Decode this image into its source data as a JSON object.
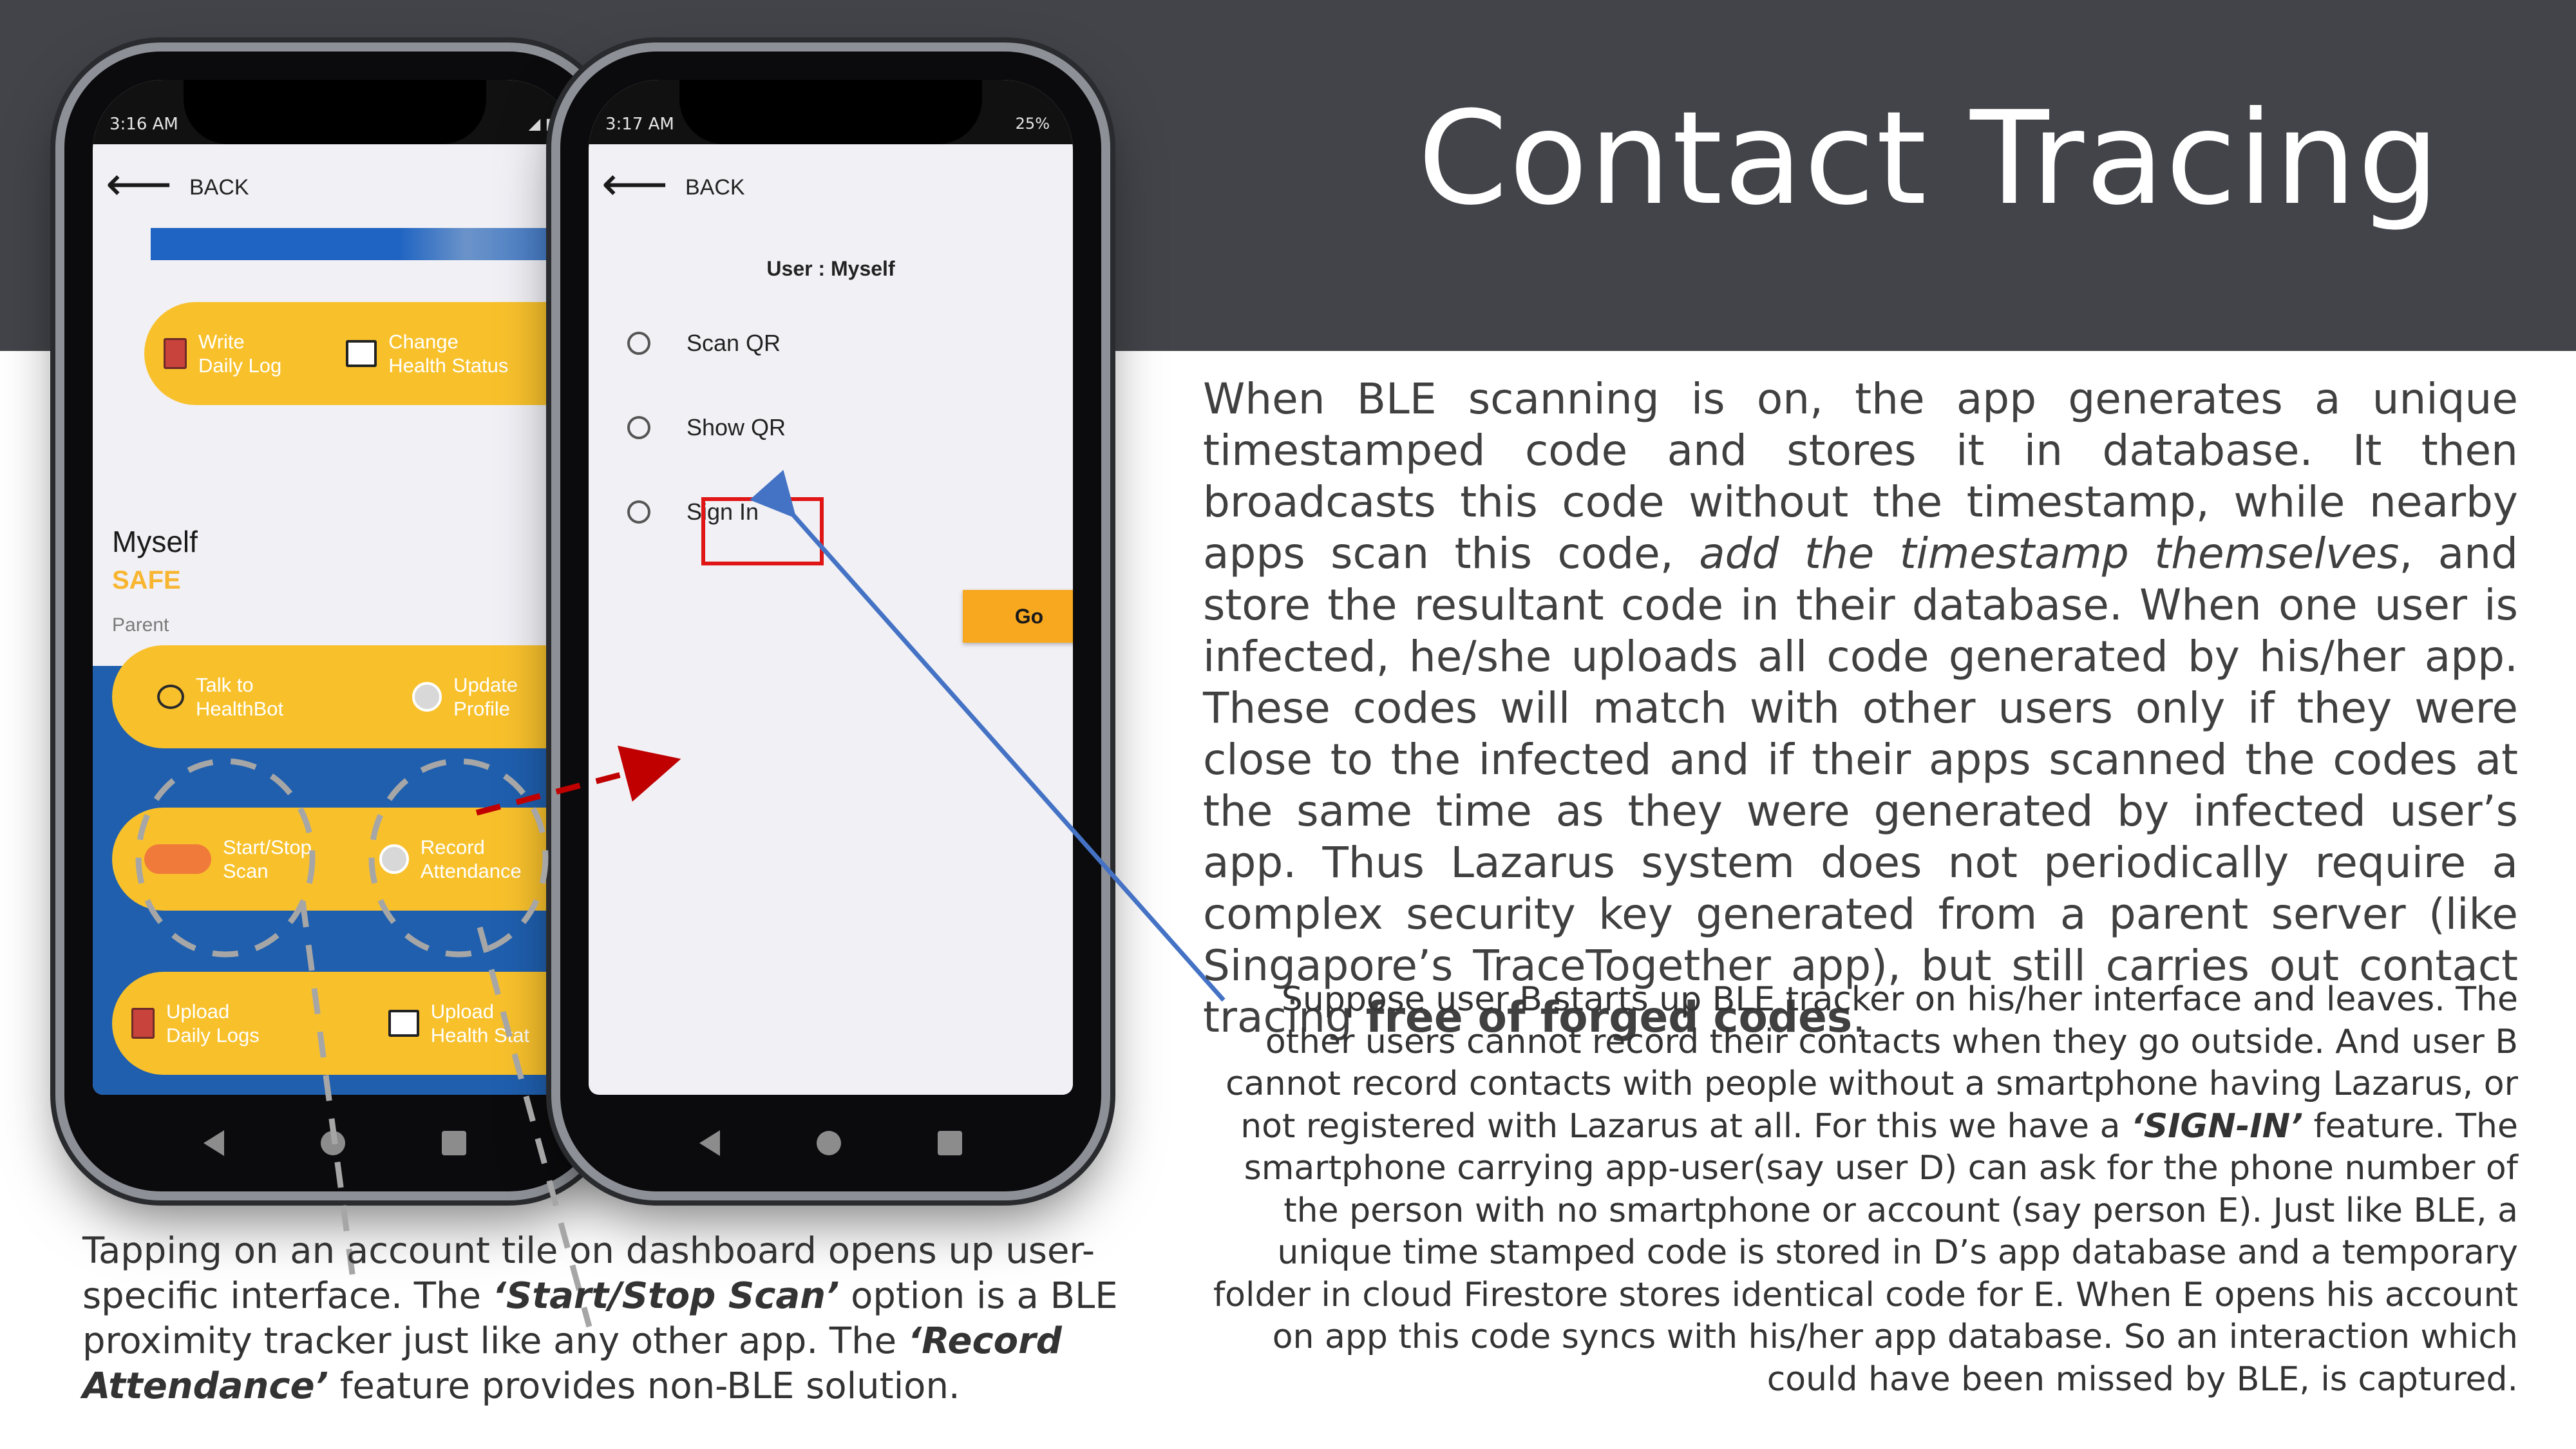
{
  "slide": {
    "title": "Contact Tracing"
  },
  "colors": {
    "header_band": "#434449",
    "accent_yellow": "#f8c12c",
    "blue_area": "#1f5fae",
    "highlight_red": "#e01616",
    "arrow_blue": "#4472c4",
    "arrow_red": "#c00000",
    "dashed_gray": "#a6a6a6"
  },
  "phone1": {
    "status_time": "3:16 AM",
    "back_label": "BACK",
    "row1": {
      "left_label_1": "Write",
      "left_label_2": "Daily Log",
      "right_label_1": "Change",
      "right_label_2": "Health Status"
    },
    "profile": {
      "name": "Myself",
      "status": "SAFE",
      "role": "Parent"
    },
    "row2": {
      "left_label_1": "Talk to",
      "left_label_2": "HealthBot",
      "right_label_1": "Update",
      "right_label_2": "Profile"
    },
    "row3": {
      "left_label_1": "Start/Stop",
      "left_label_2": "Scan",
      "right_label_1": "Record",
      "right_label_2": "Attendance"
    },
    "row4": {
      "left_label_1": "Upload",
      "left_label_2": "Daily Logs",
      "right_label_1": "Upload",
      "right_label_2": "Health Stat"
    }
  },
  "phone2": {
    "status_time": "3:17 AM",
    "status_right": "25%",
    "back_label": "BACK",
    "user_line": "User : Myself",
    "options": [
      "Scan QR",
      "Show QR",
      "Sign In"
    ],
    "go_label": "Go"
  },
  "text": {
    "main_a": "When BLE scanning is on, the app generates a unique timestamped code and stores it in database. It then broadcasts this code without the timestamp, while nearby apps scan this code, ",
    "main_italic": "add the timestamp themselves",
    "main_b": ", and store the resultant code in their database. When one user is infected, he/she uploads all code generated by his/her app. These codes will match with other users only if they were close to the infected and if their apps scanned the codes at the same time as they were generated by infected user’s app. Thus Lazarus system does not periodically require a complex security key generated from a parent server (like Singapore’s TraceTogether app), but still carries out contact tracing ",
    "main_bold": "free of forged codes",
    "main_end": ".",
    "sec_a": "Suppose user B starts up BLE tracker on his/her interface and leaves. The other users cannot  record their contacts when they go outside. And user B cannot record contacts with people without a smartphone having Lazarus, or not registered with Lazarus at all. For this we have a ",
    "sec_bold": "‘SIGN-IN’",
    "sec_b": " feature. The smartphone  carrying app-user(say user D) can ask for the phone number of the person with no smartphone or account (say person E). Just like BLE, a unique time stamped code is stored in D’s app database and a temporary folder in cloud Firestore stores identical code for E. When E opens his account on app this code syncs with his/her app database. So an interaction which could have been missed by BLE, is captured.",
    "bottom_a": "Tapping on an account tile on dashboard opens up user-specific interface. The ",
    "bottom_bold1": "‘Start/Stop Scan’",
    "bottom_b": " option is a BLE proximity tracker just like any other app. The ",
    "bottom_bold2": "‘Record Attendance’",
    "bottom_c": " feature provides non-BLE solution."
  }
}
